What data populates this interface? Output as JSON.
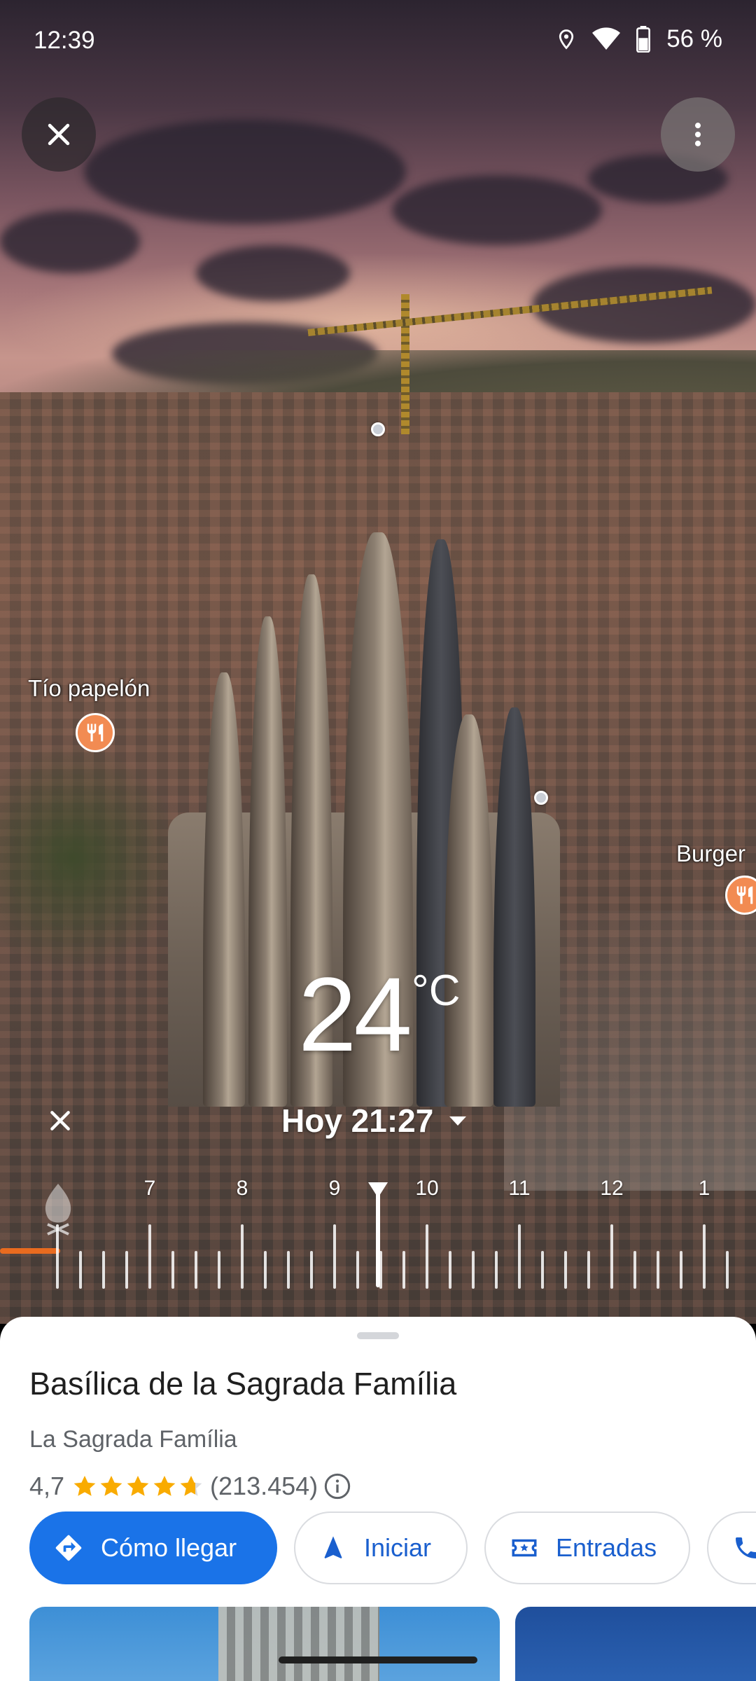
{
  "status_bar": {
    "time": "12:39",
    "battery": "56 %",
    "icons": [
      "location-icon",
      "wifi-icon",
      "battery-icon"
    ]
  },
  "scene": {
    "labels": [
      {
        "name": "Tío papelón",
        "icon": "restaurant-icon"
      },
      {
        "name": "Burger",
        "icon": "restaurant-icon"
      }
    ]
  },
  "weather": {
    "temperature": "24",
    "unit": "°C"
  },
  "time_selector": {
    "label": "Hoy 21:27"
  },
  "timeline": {
    "hours": [
      "7",
      "8",
      "9",
      "10",
      "11",
      "12",
      "1"
    ],
    "current_hour_fraction": 0.45
  },
  "place": {
    "title": "Basílica de la Sagrada Família",
    "subtitle": "La Sagrada Família",
    "rating": "4,7",
    "rating_value": 4.7,
    "review_count": "(213.454)"
  },
  "actions": [
    {
      "label": "Cómo llegar",
      "icon": "directions-icon"
    },
    {
      "label": "Iniciar",
      "icon": "navigation-arrow-icon"
    },
    {
      "label": "Entradas",
      "icon": "ticket-icon"
    },
    {
      "label": "",
      "icon": "phone-icon"
    }
  ],
  "colors": {
    "accent": "#1a73e8",
    "star": "#f9ab00",
    "restaurant_pin": "#f28b52"
  }
}
